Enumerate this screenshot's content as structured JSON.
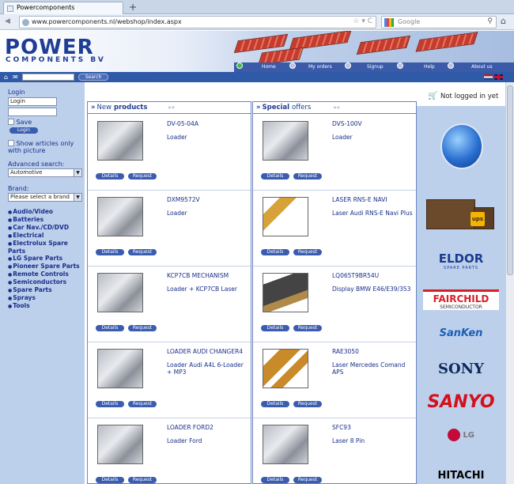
{
  "browser": {
    "tab_title": "Powercomponents",
    "url": "www.powercomponents.nl/webshop/index.aspx",
    "search_placeholder": "Google"
  },
  "header": {
    "logo_main": "POWER",
    "logo_sub": "COMPONENTS BV",
    "menu": [
      "Home",
      "My orders",
      "Signup",
      "Help",
      "About us"
    ],
    "quick_search_button": "Search"
  },
  "sidebar": {
    "login_label": "Login",
    "login_value": "Login",
    "save_label": "Save",
    "login_button": "Login",
    "show_articles_label": "Show articles only with picture",
    "advanced_search_label": "Advanced search:",
    "advanced_search_value": "Automotive",
    "brand_label": "Brand:",
    "brand_value": "Please select a brand",
    "categories": [
      "Audio/Video",
      "Batteries",
      "Car Nav./CD/DVD",
      "Electrical",
      "Electrolux Spare Parts",
      "LG Spare Parts",
      "Pioneer Spare Parts",
      "Remote Controls",
      "Semiconductors",
      "Spare Parts",
      "Sprays",
      "Tools"
    ]
  },
  "new_products": {
    "title_a": "New",
    "title_b": "products",
    "items": [
      {
        "name": "DV-05-04A",
        "desc": "Loader"
      },
      {
        "name": "DXM9572V",
        "desc": "Loader"
      },
      {
        "name": "KCP7CB MECHANISM",
        "desc": "Loader + KCP7CB Laser"
      },
      {
        "name": "LOADER AUDI CHANGER4",
        "desc": "Loader Audi A4L 6-Loader + MP3"
      },
      {
        "name": "LOADER FORD2",
        "desc": "Loader Ford"
      }
    ]
  },
  "special_offers": {
    "title_a": "Special",
    "title_b": "offers",
    "items": [
      {
        "name": "DVS-100V",
        "desc": "Loader"
      },
      {
        "name": "LASER RNS-E NAVI",
        "desc": "Laser Audi RNS-E Navi Plus"
      },
      {
        "name": "LQ065T9BR54U",
        "desc": "Display BMW E46/E39/353"
      },
      {
        "name": "RAE3050",
        "desc": "Laser Mercedes Comand APS"
      },
      {
        "name": "SFC93",
        "desc": "Laser 8 Pin"
      }
    ]
  },
  "buttons": {
    "details": "Details",
    "request": "Request"
  },
  "right": {
    "login_status": "Not logged in yet",
    "brands": [
      "ELDOR",
      "SPARE PARTS",
      "FAIRCHILD",
      "SEMICONDUCTOR",
      "SanKen",
      "SONY",
      "SANYO",
      "LG",
      "HITACHI"
    ],
    "ups_label": "ups"
  },
  "colors": {
    "accent": "#1f3d94",
    "sidebar_bg": "#bcd0ec",
    "button": "#3a5db0"
  }
}
